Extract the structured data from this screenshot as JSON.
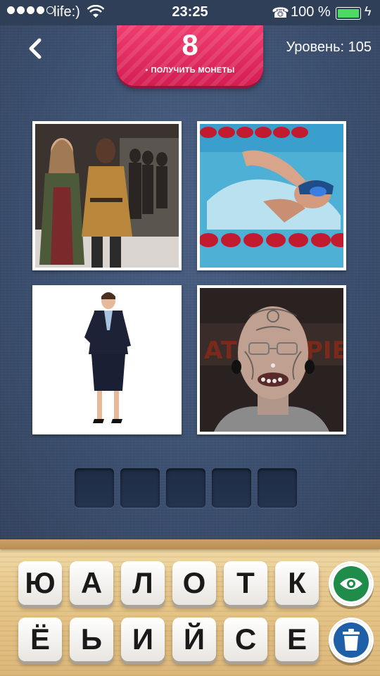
{
  "status_bar": {
    "carrier": "life:)",
    "time": "23:25",
    "battery_percent": "100 %"
  },
  "header": {
    "back_label": "<",
    "coins": "8",
    "get_coins_label": "ПОЛУЧИТЬ МОНЕТЫ",
    "level_label": "Уровень: 105"
  },
  "puzzle": {
    "photos": [
      {
        "subject": "fashion runway models"
      },
      {
        "subject": "swimmer in pool"
      },
      {
        "subject": "woman in business suit"
      },
      {
        "subject": "tattooed pierced man"
      }
    ],
    "answer_slots": [
      "",
      "",
      "",
      "",
      ""
    ]
  },
  "keyboard": {
    "row1": [
      "Ю",
      "А",
      "Л",
      "О",
      "Т",
      "К"
    ],
    "row2": [
      "Ё",
      "Ь",
      "И",
      "Й",
      "С",
      "Е"
    ]
  },
  "buttons": {
    "reveal_icon": "eye-icon",
    "remove_icon": "trash-icon"
  },
  "colors": {
    "banner": "#e22a5e",
    "background": "#3e5272",
    "reveal": "#1f8c4a",
    "remove": "#1f5fa8"
  }
}
